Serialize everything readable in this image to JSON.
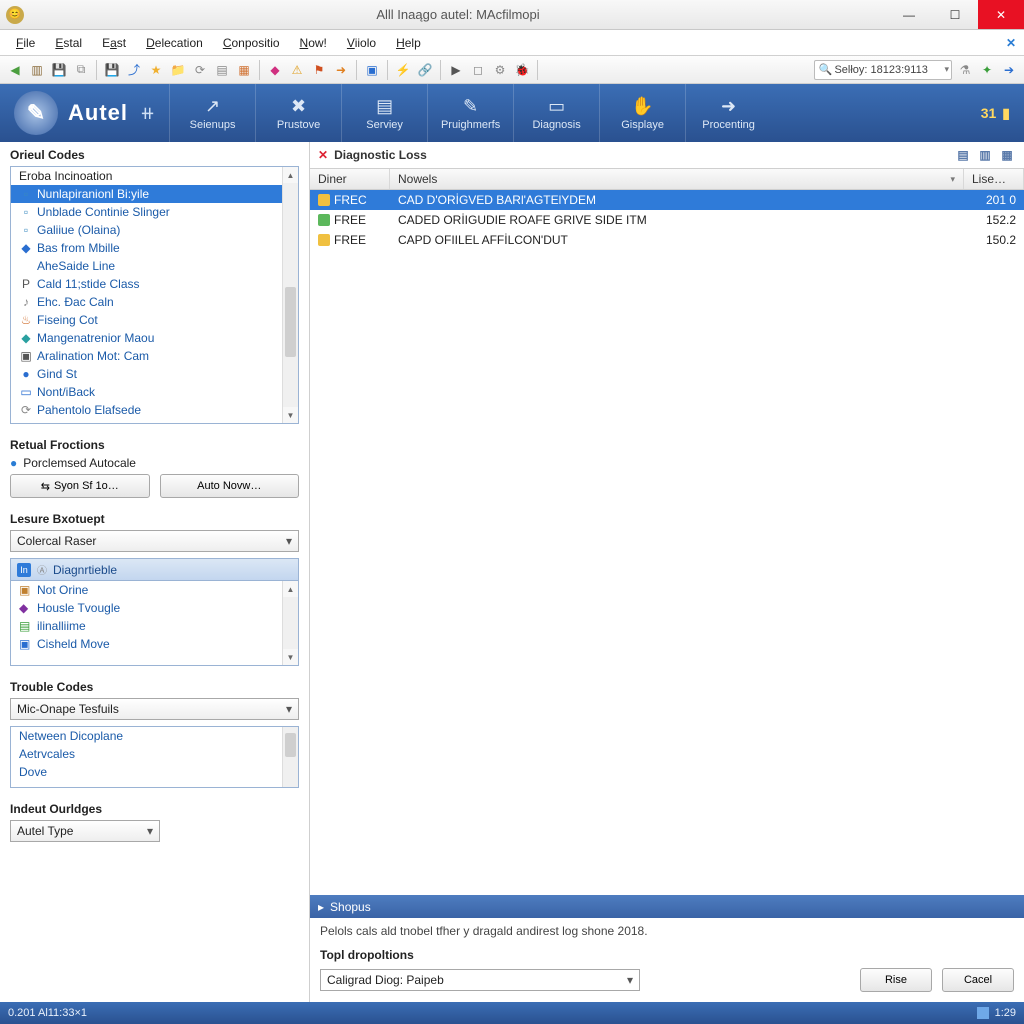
{
  "window": {
    "title": "Alll Inaągo autel: MAcfilmopi"
  },
  "menu": [
    "File",
    "Estal",
    "East",
    "Delecation",
    "Conpositio",
    "Now!",
    "Viiolo",
    "Help"
  ],
  "search_value": "Selłoy: 18123:9113",
  "brand": {
    "name": "Autel",
    "plus": "⧺"
  },
  "modules": [
    {
      "label": "Seienups"
    },
    {
      "label": "Prustove"
    },
    {
      "label": "Serviey"
    },
    {
      "label": "Pruighmerfs"
    },
    {
      "label": "Diagnosis"
    },
    {
      "label": "Gisplaye"
    },
    {
      "label": "Procenting"
    }
  ],
  "band_right_count": "31",
  "sidebar": {
    "codes_title": "Orieul Codes",
    "codes_header": "Eroba Incinoation",
    "codes": [
      "Nunlapiranionl Bi:yile",
      "Unblade Continie Slinger",
      "Galiiue (Olaina)",
      "Bas from Mbille",
      "AheSaide Line",
      "Cald 11;stide Class",
      "Ehc. Đac Caln",
      "Fiseing Cot",
      "Mangenatrenior Maou",
      "Aralination Mot: Cam",
      "Gind St",
      "Nont/iBack",
      "Pahentolo Elafsede"
    ],
    "functions_title": "Retual Froctions",
    "functions_sub": "Porclemsed Autocale",
    "btn_sync": "Syon Sf 1o…",
    "btn_auto": "Auto Novw…",
    "lesure_title": "Lesure Bxotuept",
    "lesure_dd": "Colercal Raser",
    "diag_tab": "Diagnrtieble",
    "diag_items": [
      "Not Orine",
      "Housle Tvougle",
      "ilinalliime",
      "Cisheld Move"
    ],
    "trouble_title": "Trouble Codes",
    "trouble_dd": "Mic-Onape Tesfuils",
    "trouble_items": [
      "Netween Dicoplane",
      "Aetrvcales",
      "Dove"
    ],
    "indent_title": "Indeut Ourldges",
    "indent_dd": "Autel Type"
  },
  "content": {
    "header": "Diagnostic Loss",
    "columns": [
      "Diner",
      "Nowels",
      "Lise…"
    ],
    "rows": [
      {
        "code": "FREC",
        "desc": "CAD D'ORİGVED BARl'AGTElYDEM",
        "val": "201 0",
        "sel": true,
        "ico": "y"
      },
      {
        "code": "FREE",
        "desc": "CADED ORİIGUDIE ROAFE GRIVE SIDE ITM",
        "val": "152.2",
        "sel": false,
        "ico": "g"
      },
      {
        "code": "FREE",
        "desc": "CAPD OFIILEL AFFİLCON'DUT",
        "val": "150.2",
        "sel": false,
        "ico": "y"
      }
    ],
    "shapes_label": "Shopus",
    "info_text": "Pelols cals ald tnobel tfher y dragald andirest log shone 2018.",
    "drop_label": "Topl dropoltions",
    "drop_value": "Caligrad Diog: Paipeb",
    "btn_ok": "Rise",
    "btn_cancel": "Cacel"
  },
  "status": {
    "left": "0.201 Al11:33×1",
    "right": "1:29"
  }
}
